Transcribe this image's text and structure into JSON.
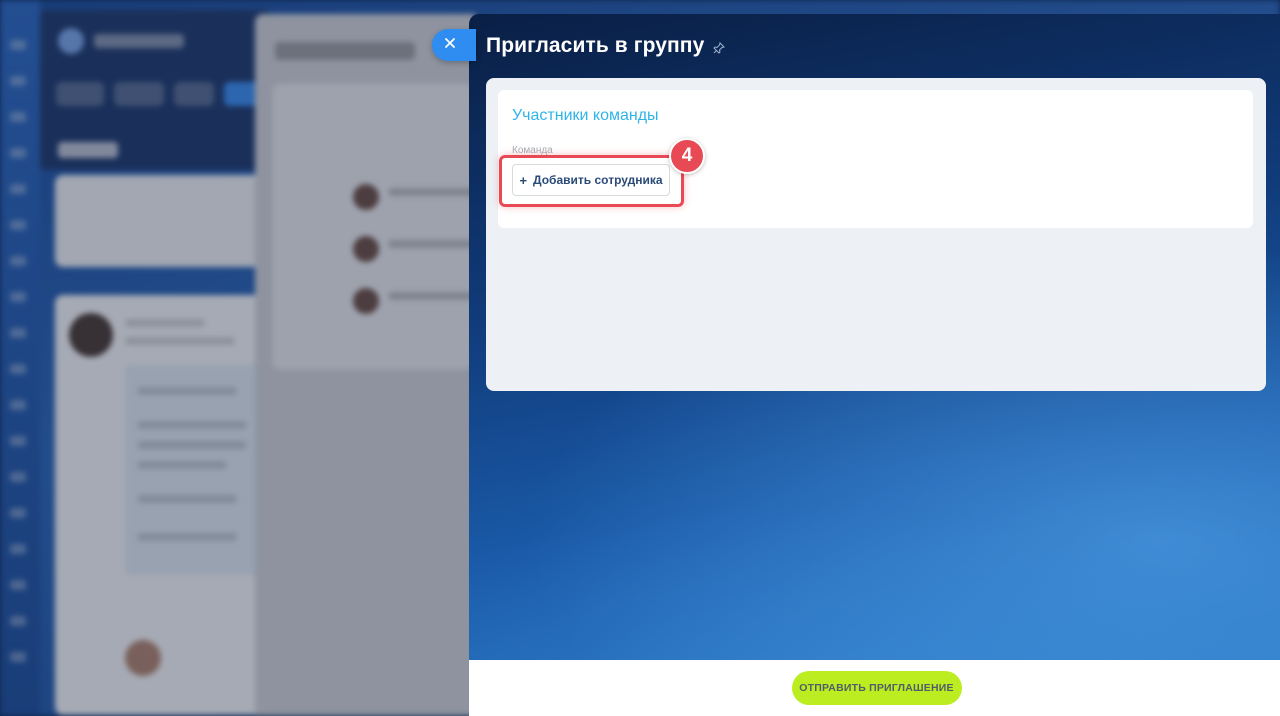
{
  "slider": {
    "title": "Пригласить в группу",
    "pin_icon": "pin-icon",
    "close_icon": "close-icon"
  },
  "team_section": {
    "title": "Участники команды",
    "field_label": "Команда",
    "add_button_label": "Добавить сотрудника",
    "add_icon": "plus-icon"
  },
  "tutorial": {
    "step_number": "4"
  },
  "footer": {
    "send_button_label": "ОТПРАВИТЬ ПРИГЛАШЕНИЕ"
  },
  "colors": {
    "section_title": "#2fb4e8",
    "highlight": "#e84a55",
    "send_button": "#bbed21",
    "close_tab": "#2f8cf0"
  }
}
